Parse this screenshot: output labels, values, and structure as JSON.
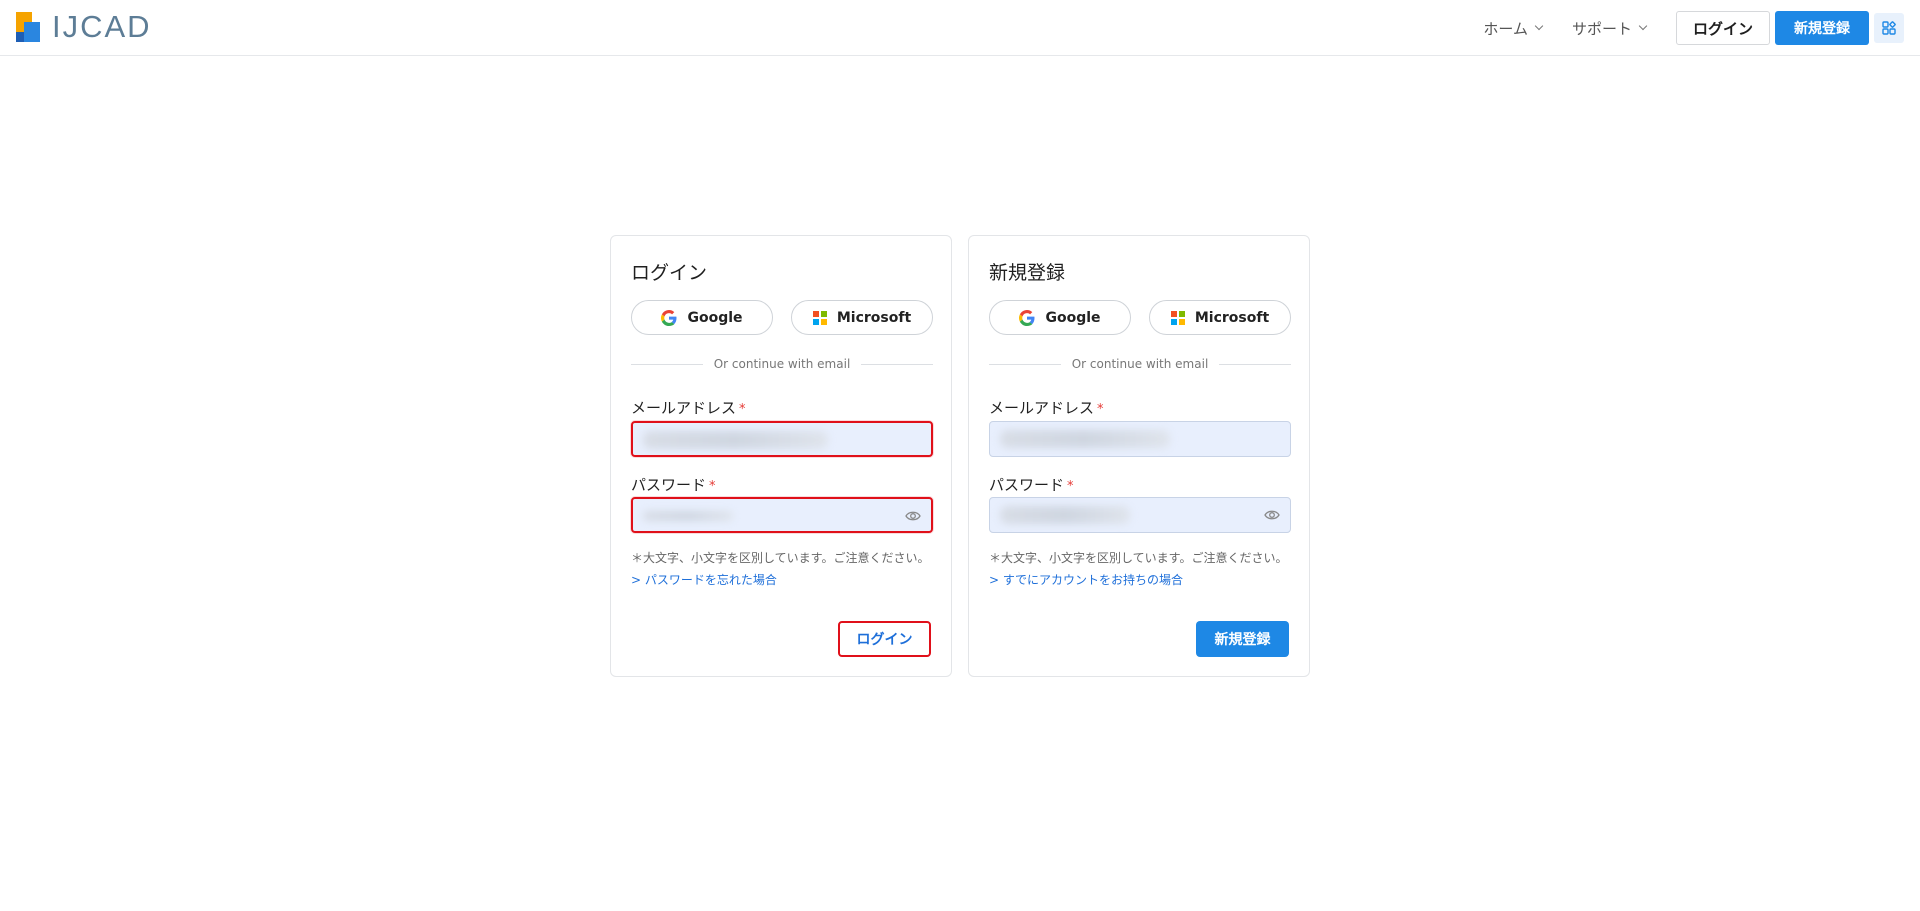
{
  "header": {
    "logo_text": "IJCAD",
    "nav": [
      {
        "label": "ホーム"
      },
      {
        "label": "サポート"
      }
    ],
    "login_label": "ログイン",
    "register_label": "新規登録"
  },
  "login_card": {
    "title": "ログイン",
    "google_label": "Google",
    "microsoft_label": "Microsoft",
    "divider_text": "Or continue with email",
    "email_label": "メールアドレス",
    "password_label": "パスワード",
    "required_mark": "*",
    "note": "＊大文字、小文字を区別しています。ご注意ください。",
    "link": "> パスワードを忘れた場合",
    "submit_label": "ログイン"
  },
  "register_card": {
    "title": "新規登録",
    "google_label": "Google",
    "microsoft_label": "Microsoft",
    "divider_text": "Or continue with email",
    "email_label": "メールアドレス",
    "password_label": "パスワード",
    "required_mark": "*",
    "note": "＊大文字、小文字を区別しています。ご注意ください。",
    "link": "> すでにアカウントをお持ちの場合",
    "submit_label": "新規登録"
  },
  "colors": {
    "primary": "#1e88e5",
    "error_outline": "#e0101a",
    "link": "#1e6fd9",
    "logo_text": "#5d7d96"
  }
}
